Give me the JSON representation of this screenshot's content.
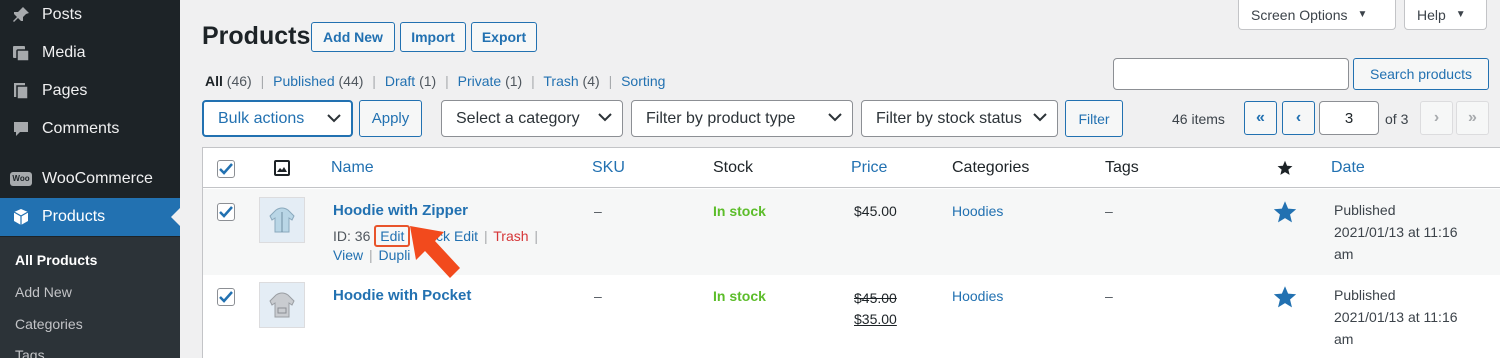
{
  "sidebar": {
    "items": [
      {
        "label": "Posts",
        "icon": "pin-icon"
      },
      {
        "label": "Media",
        "icon": "media-icon"
      },
      {
        "label": "Pages",
        "icon": "pages-icon"
      },
      {
        "label": "Comments",
        "icon": "comment-icon"
      },
      {
        "label": "WooCommerce",
        "icon": "woocommerce-icon",
        "badge": "Woo"
      },
      {
        "label": "Products",
        "icon": "box-icon",
        "active": true
      }
    ],
    "submenu": [
      "All Products",
      "Add New",
      "Categories",
      "Tags"
    ]
  },
  "header": {
    "title": "Products",
    "add_new": "Add New",
    "import": "Import",
    "export": "Export",
    "screen_options": "Screen Options",
    "help": "Help"
  },
  "views": {
    "all": "All",
    "all_count": "(46)",
    "published": "Published",
    "published_count": "(44)",
    "draft": "Draft",
    "draft_count": "(1)",
    "private": "Private",
    "private_count": "(1)",
    "trash": "Trash",
    "trash_count": "(4)",
    "sorting": "Sorting",
    "sep": "|"
  },
  "search": {
    "value": "",
    "button": "Search products"
  },
  "filters": {
    "bulk_actions": "Bulk actions",
    "apply": "Apply",
    "category": "Select a category",
    "product_type": "Filter by product type",
    "stock_status": "Filter by stock status",
    "filter": "Filter"
  },
  "pagination": {
    "items": "46 items",
    "first": "«",
    "prev": "‹",
    "current": "3",
    "of": "of 3",
    "next": "›",
    "last": "»"
  },
  "table": {
    "columns": {
      "name": "Name",
      "sku": "SKU",
      "stock": "Stock",
      "price": "Price",
      "categories": "Categories",
      "tags": "Tags",
      "date": "Date"
    },
    "rows": [
      {
        "name": "Hoodie with Zipper",
        "id": "ID: 36",
        "edit": "Edit",
        "quick_edit": "Quick Edit",
        "trash": "Trash",
        "view": "View",
        "duplicate": "Dupli",
        "sku": "–",
        "stock": "In stock",
        "price": "$45.00",
        "categories": "Hoodies",
        "tags": "–",
        "date_status": "Published",
        "date_value": "2021/01/13 at 11:16",
        "date_suffix": "am",
        "checked": true
      },
      {
        "name": "Hoodie with Pocket",
        "sku": "–",
        "stock": "In stock",
        "price_old": "$45.00",
        "price": "$35.00",
        "categories": "Hoodies",
        "tags": "–",
        "date_status": "Published",
        "date_value": "2021/01/13 at 11:16",
        "date_suffix": "am",
        "checked": true
      }
    ]
  },
  "colors": {
    "accent": "#2271b1",
    "sidebar": "#1d2327",
    "in_stock": "#5cbd2a",
    "trash": "#d63638",
    "highlight": "#e8542b"
  }
}
